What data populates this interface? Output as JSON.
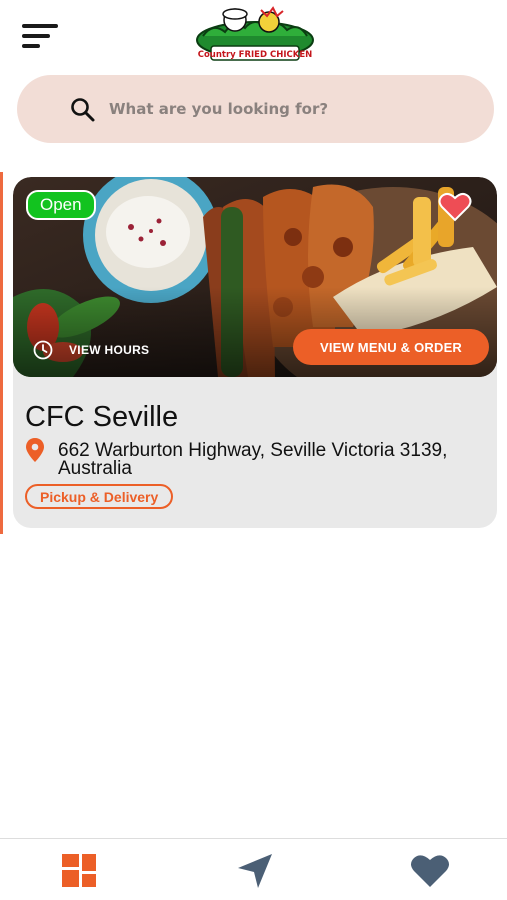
{
  "header": {
    "menu_icon": "hamburger-menu-icon",
    "logo": {
      "brand": "Country FRIED CHICKEN",
      "icon": "cfc-logo"
    }
  },
  "search": {
    "placeholder": "What are you looking for?",
    "value": "",
    "icon": "search-icon"
  },
  "store": {
    "status": "Open",
    "status_color": "#12c31f",
    "favorite_icon": "heart-icon",
    "favorite_color": "#ee4d55",
    "hours_label": "VIEW HOURS",
    "order_label": "VIEW MENU & ORDER",
    "name": "CFC Seville",
    "address": "662 Warburton Highway, Seville Victoria 3139, Australia",
    "service": "Pickup & Delivery"
  },
  "nav": {
    "items": [
      {
        "name": "home",
        "icon": "grid-icon",
        "active": true
      },
      {
        "name": "locations",
        "icon": "navigation-arrow-icon",
        "active": false
      },
      {
        "name": "favorites",
        "icon": "heart-icon",
        "active": false
      }
    ]
  },
  "colors": {
    "accent": "#ec5f27",
    "search_bg": "#f2ddd6",
    "card_bg": "#e9e9e9",
    "nav_inactive": "#4b5f75"
  }
}
